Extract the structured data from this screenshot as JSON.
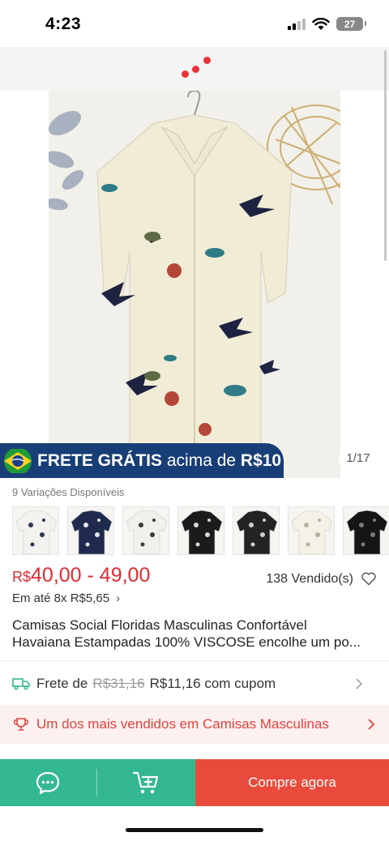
{
  "status_bar": {
    "time": "4:23",
    "battery": "27"
  },
  "loading": {
    "dot_color": "#e8343a"
  },
  "gallery": {
    "promo_strong": "FRETE GRÁTIS",
    "promo_rest": " acima de ",
    "promo_amount": "R$10",
    "counter": "1/17"
  },
  "variations": {
    "label": "9 Variações Disponíveis",
    "thumbnails": [
      {
        "color": "#f3f2ee",
        "print": "#2a3550"
      },
      {
        "color": "#1f2a4e",
        "print": "#e6e6e6"
      },
      {
        "color": "#f1f0ea",
        "print": "#3b3b3b"
      },
      {
        "color": "#1b1b1b",
        "print": "#d8d8d8"
      },
      {
        "color": "#232323",
        "print": "#cfcfcf"
      },
      {
        "color": "#f4f1e6",
        "print": "#b8b1a0"
      },
      {
        "color": "#151515",
        "print": "#7a7a7a"
      }
    ]
  },
  "price": {
    "currency": "R$",
    "range": "40,00 - 49,00",
    "sold": "138 Vendido(s)",
    "installments": "Em até 8x R$5,65"
  },
  "product": {
    "title_line1": "Camisas Social Floridas Masculinas Confortável",
    "title_line2": "Havaiana Estampadas  100% VISCOSE encolhe um po..."
  },
  "shipping": {
    "prefix": "Frete de",
    "old_price": "R$31,16",
    "new_price": "R$11,16 com cupom"
  },
  "bestseller": {
    "text": "Um dos mais vendidos em Camisas Masculinas"
  },
  "bottom_bar": {
    "buy_label": "Compre agora",
    "accent_green": "#33b88f",
    "accent_red": "#e84b3c"
  }
}
